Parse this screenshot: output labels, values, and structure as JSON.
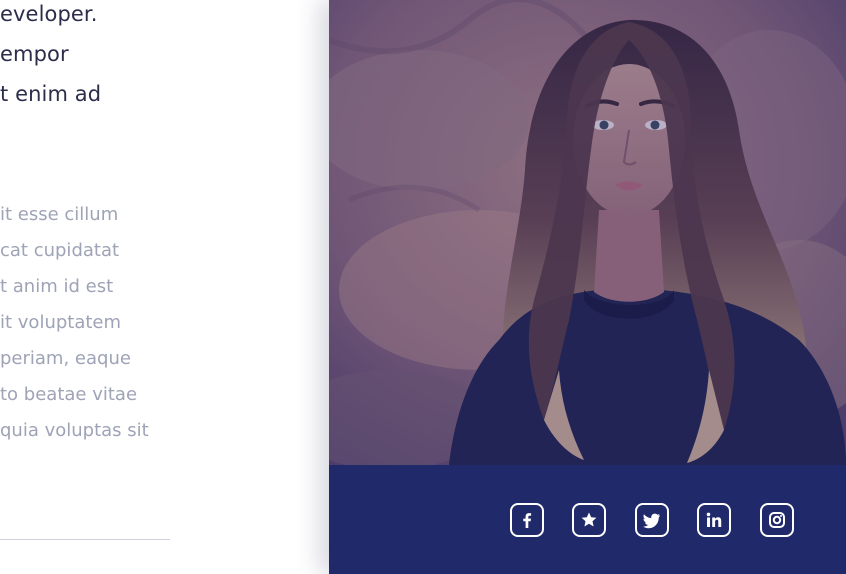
{
  "intro": {
    "heading_lines": [
      "eveloper.",
      "empor",
      "t enim ad"
    ],
    "paragraph_lines": [
      "it esse cillum",
      "cat cupidatat",
      "t anim id est",
      "it voluptatem",
      "periam, eaque",
      "to beatae vitae",
      " quia voluptas sit"
    ]
  },
  "profile": {
    "photo_icon": "portrait-photo",
    "social": [
      {
        "name": "facebook",
        "icon": "facebook-icon"
      },
      {
        "name": "star",
        "icon": "star-icon"
      },
      {
        "name": "twitter",
        "icon": "twitter-icon"
      },
      {
        "name": "linkedin",
        "icon": "linkedin-icon"
      },
      {
        "name": "instagram",
        "icon": "instagram-icon"
      }
    ]
  },
  "colors": {
    "heading": "#2b2d4a",
    "paragraph": "#9ea3b6",
    "social_bar": "#202a6b",
    "photo_overlay": "#2b2f78"
  }
}
